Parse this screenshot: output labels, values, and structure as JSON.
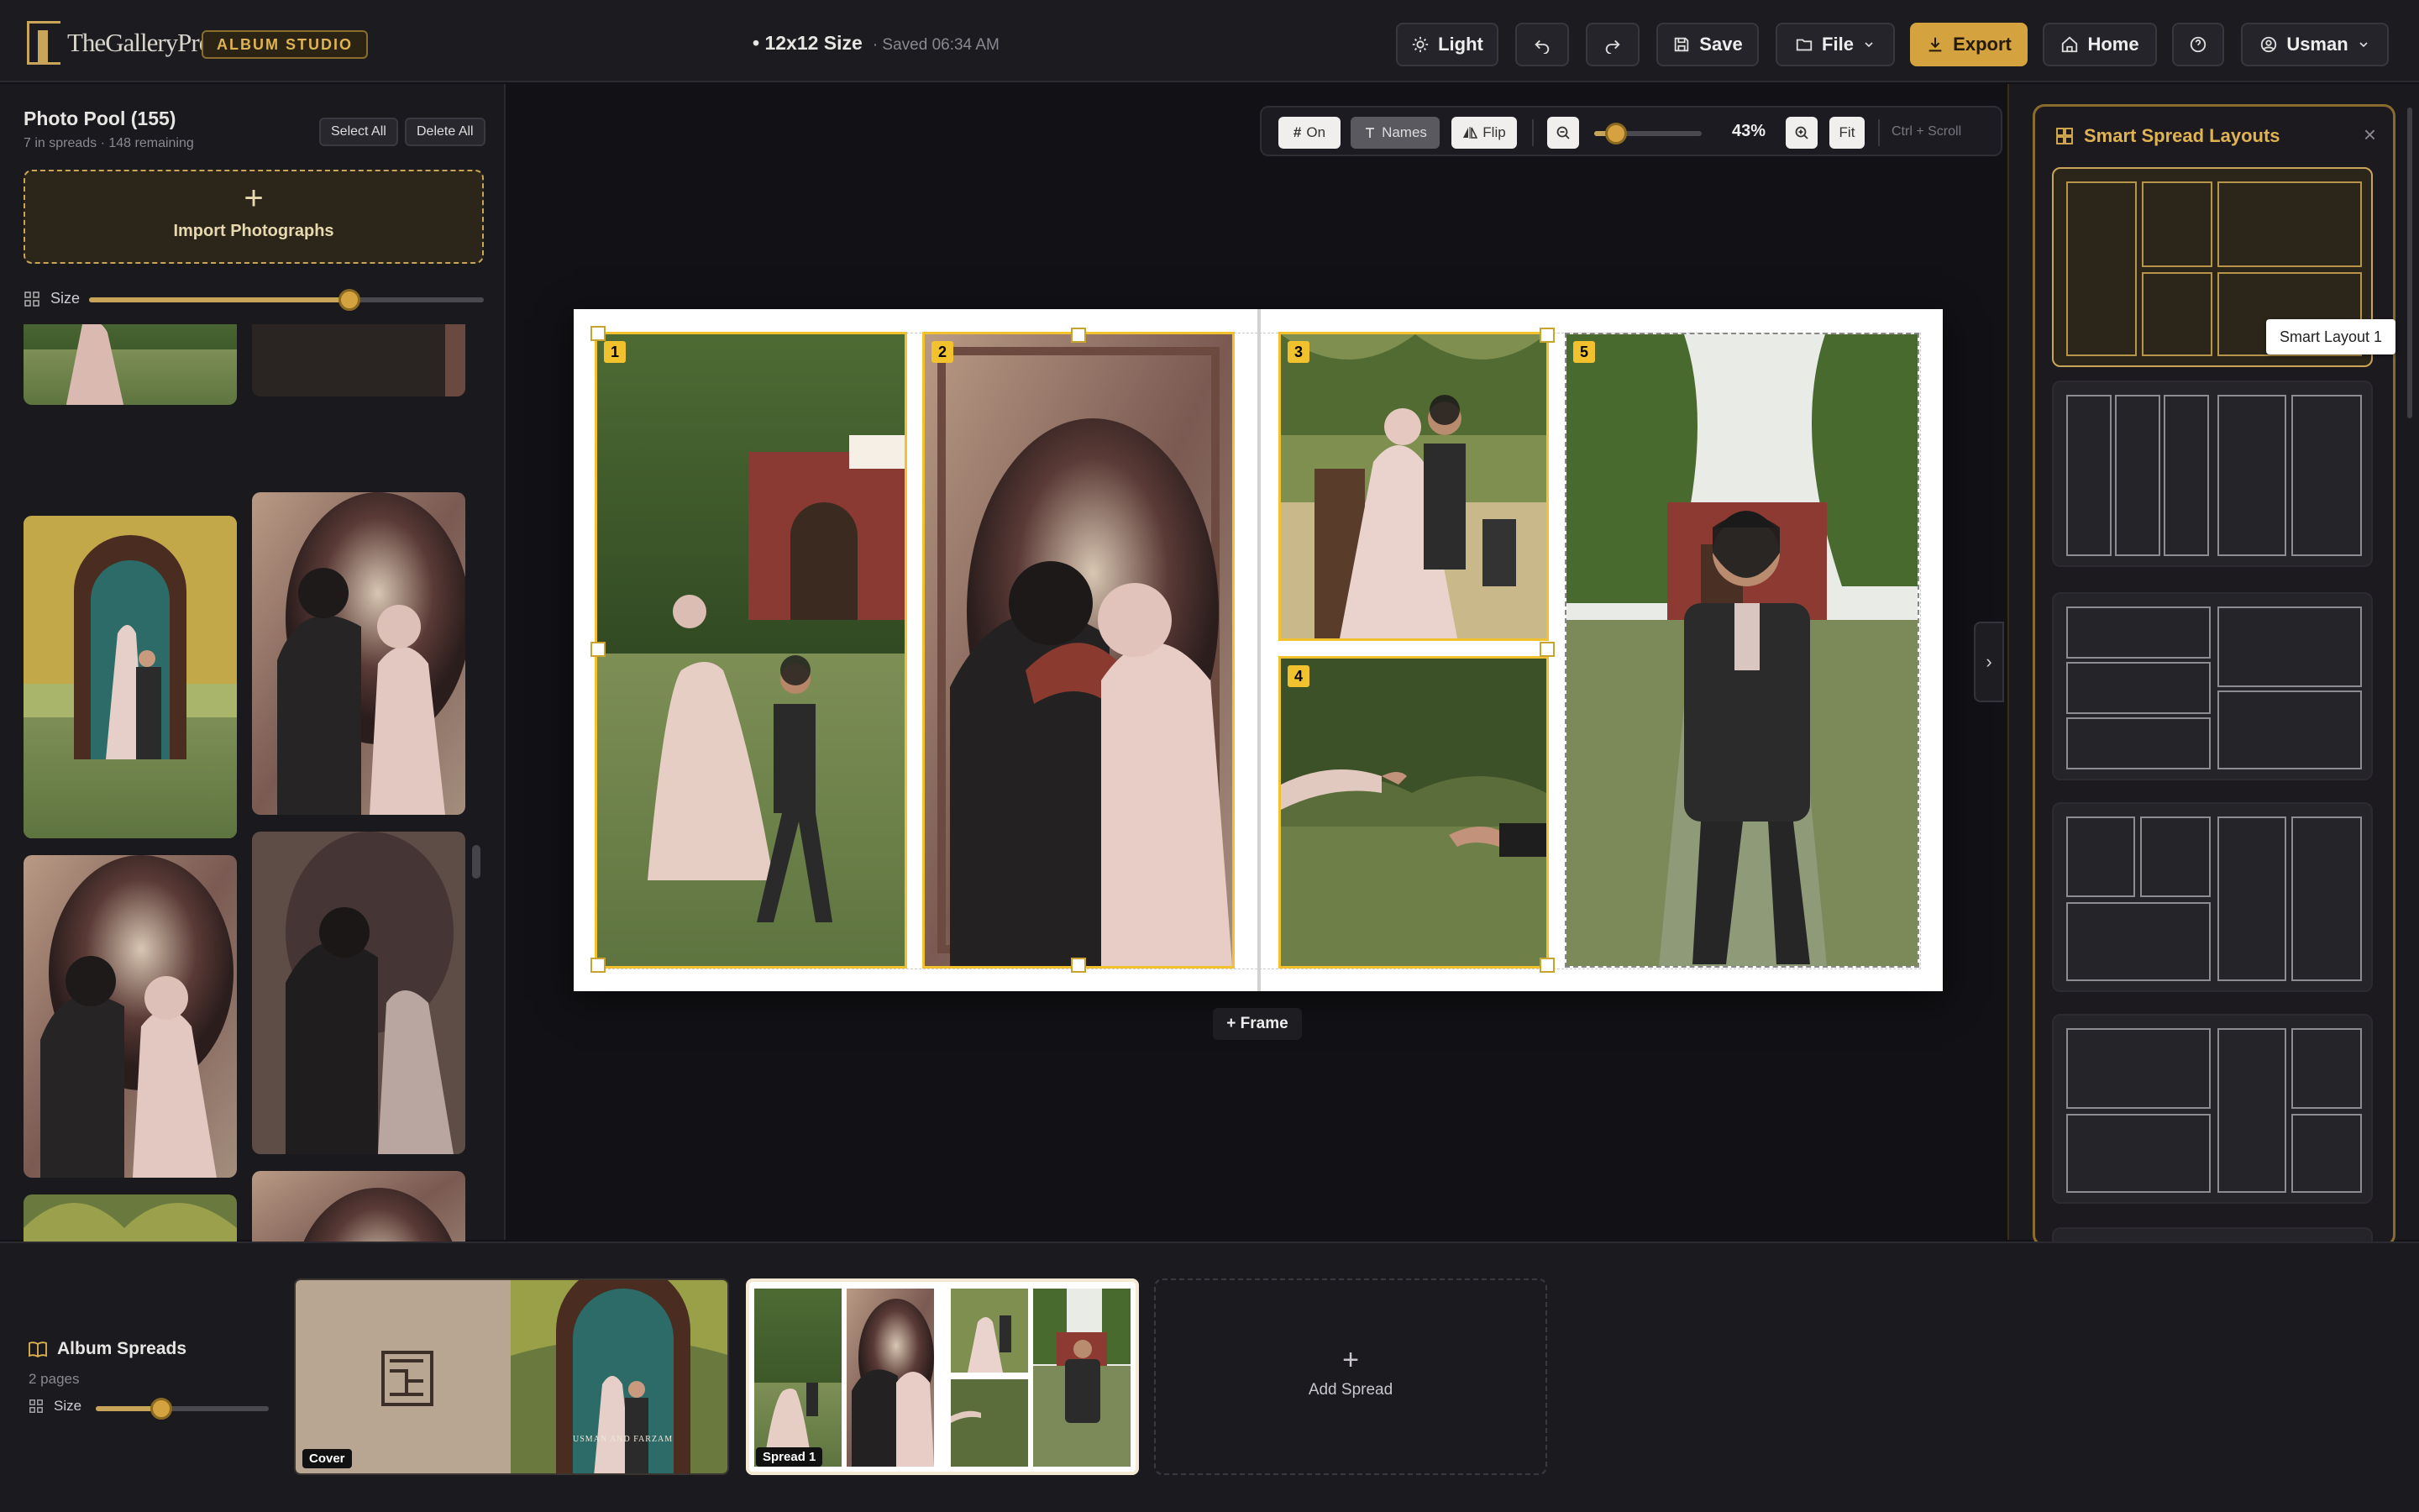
{
  "header": {
    "logo_text": "TheGalleryPro",
    "studio_badge": "ALBUM STUDIO",
    "size_label": "• 12x12 Size",
    "saved_label": "· Saved 06:34 AM",
    "buttons": {
      "light": "Light",
      "save": "Save",
      "file": "File",
      "export": "Export",
      "home": "Home",
      "user": "Usman"
    }
  },
  "photo_pool": {
    "title": "Photo Pool (155)",
    "subtitle": "7 in spreads · 148 remaining",
    "select_all": "Select All",
    "delete_all": "Delete All",
    "import_label": "Import Photographs",
    "import_plus": "+",
    "size_label": "Size",
    "size_value": 0.66
  },
  "canvas_toolbar": {
    "grid_label": "On",
    "names_label": "Names",
    "flip_label": "Flip",
    "zoom": "43%",
    "zoom_value": 0.2,
    "fit_label": "Fit",
    "hint": "Ctrl + Scroll"
  },
  "spread": {
    "frames": [
      "1",
      "2",
      "3",
      "4",
      "5"
    ],
    "add_frame": "+ Frame",
    "toggle": "›"
  },
  "layouts_panel": {
    "title": "Smart Spread Layouts",
    "close": "×",
    "tooltip": "Smart Layout 1"
  },
  "bottom": {
    "title": "Album Spreads",
    "subtitle": "2 pages",
    "size_label": "Size",
    "size_value": 0.38,
    "cards": [
      {
        "tag": "Cover",
        "caption": "USMAN AND FARZAM"
      },
      {
        "tag": "Spread 1"
      }
    ],
    "add_plus": "+",
    "add_label": "Add Spread"
  },
  "colors": {
    "accent": "#d4a23e",
    "selection": "#f2c12e",
    "background": "#121115"
  },
  "icons": [
    "sun-icon",
    "undo-icon",
    "redo-icon",
    "save-icon",
    "folder-icon",
    "chevron-down-icon",
    "download-icon",
    "home-icon",
    "help-icon",
    "user-icon",
    "grid-icon",
    "text-icon",
    "flip-icon",
    "zoom-out-icon",
    "zoom-in-icon",
    "layout-icon",
    "book-icon",
    "close-icon"
  ]
}
